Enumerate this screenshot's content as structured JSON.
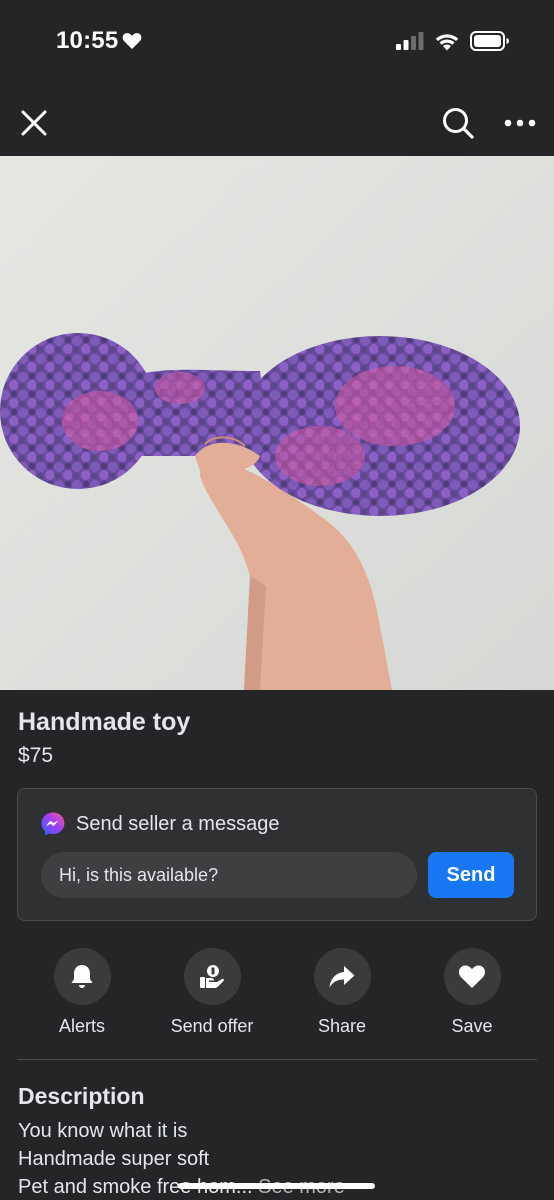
{
  "status_bar": {
    "time": "10:55",
    "icons": [
      "heart-icon",
      "signal-icon",
      "wifi-icon",
      "battery-icon"
    ]
  },
  "nav": {
    "icons": [
      "close-icon",
      "search-icon",
      "more-icon"
    ]
  },
  "listing": {
    "photo_subject": "purple crocheted toy held in hand",
    "title": "Handmade toy",
    "price": "$75"
  },
  "message": {
    "header": "Send seller a message",
    "input_value": "Hi, is this available?",
    "send_label": "Send",
    "icon": "messenger-icon",
    "accent_color": "#1877f2"
  },
  "actions": [
    {
      "label": "Alerts",
      "icon": "bell-icon"
    },
    {
      "label": "Send offer",
      "icon": "offer-icon"
    },
    {
      "label": "Share",
      "icon": "share-icon"
    },
    {
      "label": "Save",
      "icon": "heart-icon"
    }
  ],
  "description": {
    "heading": "Description",
    "lines": [
      "You know what it is",
      "Handmade super soft"
    ],
    "last_line": "Pet and smoke free hom...",
    "see_more": "See more"
  }
}
